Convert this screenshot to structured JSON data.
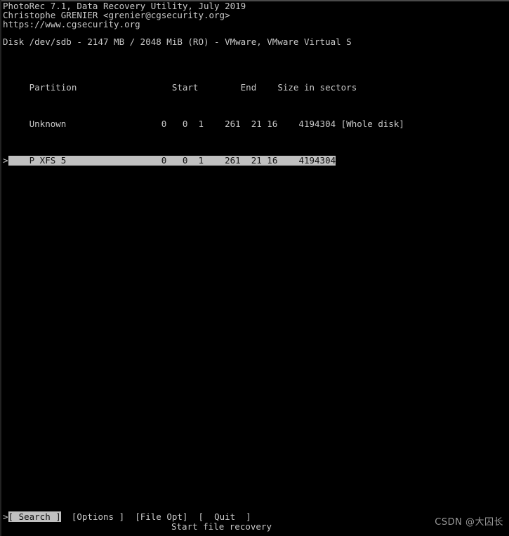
{
  "app": {
    "title_line": "PhotoRec 7.1, Data Recovery Utility, July 2019",
    "author_line": "Christophe GRENIER <grenier@cgsecurity.org>",
    "url_line": "https://www.cgsecurity.org"
  },
  "disk": {
    "line": "Disk /dev/sdb - 2147 MB / 2048 MiB (RO) - VMware, VMware Virtual S",
    "device": "/dev/sdb",
    "size_mb": "2147 MB",
    "size_mib": "2048 MiB",
    "mode": "(RO)",
    "model": "VMware, VMware Virtual S"
  },
  "table": {
    "header": {
      "partition": "Partition",
      "start": "Start",
      "end": "End",
      "size": "Size in sectors"
    },
    "header_line": "     Partition                  Start        End    Size in sectors",
    "rows": [
      {
        "marker": " ",
        "name_line": "     Unknown                  0   0  1    261  21 16    4194304 [Whole disk]",
        "label": "Unknown",
        "start_cyl": "0",
        "start_head": "0",
        "start_sect": "1",
        "end_cyl": "261",
        "end_head": "21",
        "end_sect": "16",
        "sectors": "4194304",
        "note": "[Whole disk]",
        "selected": false
      },
      {
        "marker": ">",
        "prefix": "    P XFS 5",
        "mid": "                  0   0  1    261  21 16    4194304",
        "label": "P XFS 5",
        "start_cyl": "0",
        "start_head": "0",
        "start_sect": "1",
        "end_cyl": "261",
        "end_head": "21",
        "end_sect": "16",
        "sectors": "4194304",
        "note": "",
        "selected": true
      }
    ]
  },
  "menu": {
    "marker": ">",
    "items": [
      {
        "label": "[ Search ]",
        "selected": true
      },
      {
        "label": "[Options ]",
        "selected": false
      },
      {
        "label": "[File Opt]",
        "selected": false
      },
      {
        "label": "[  Quit  ]",
        "selected": false
      }
    ],
    "gap": "  ",
    "hint": "Start file recovery"
  },
  "watermark": {
    "text": "CSDN @大囚长"
  },
  "colors": {
    "background": "#000000",
    "foreground": "#c9c9c9",
    "highlight_bg": "#c0c0c0",
    "highlight_fg": "#111111"
  }
}
